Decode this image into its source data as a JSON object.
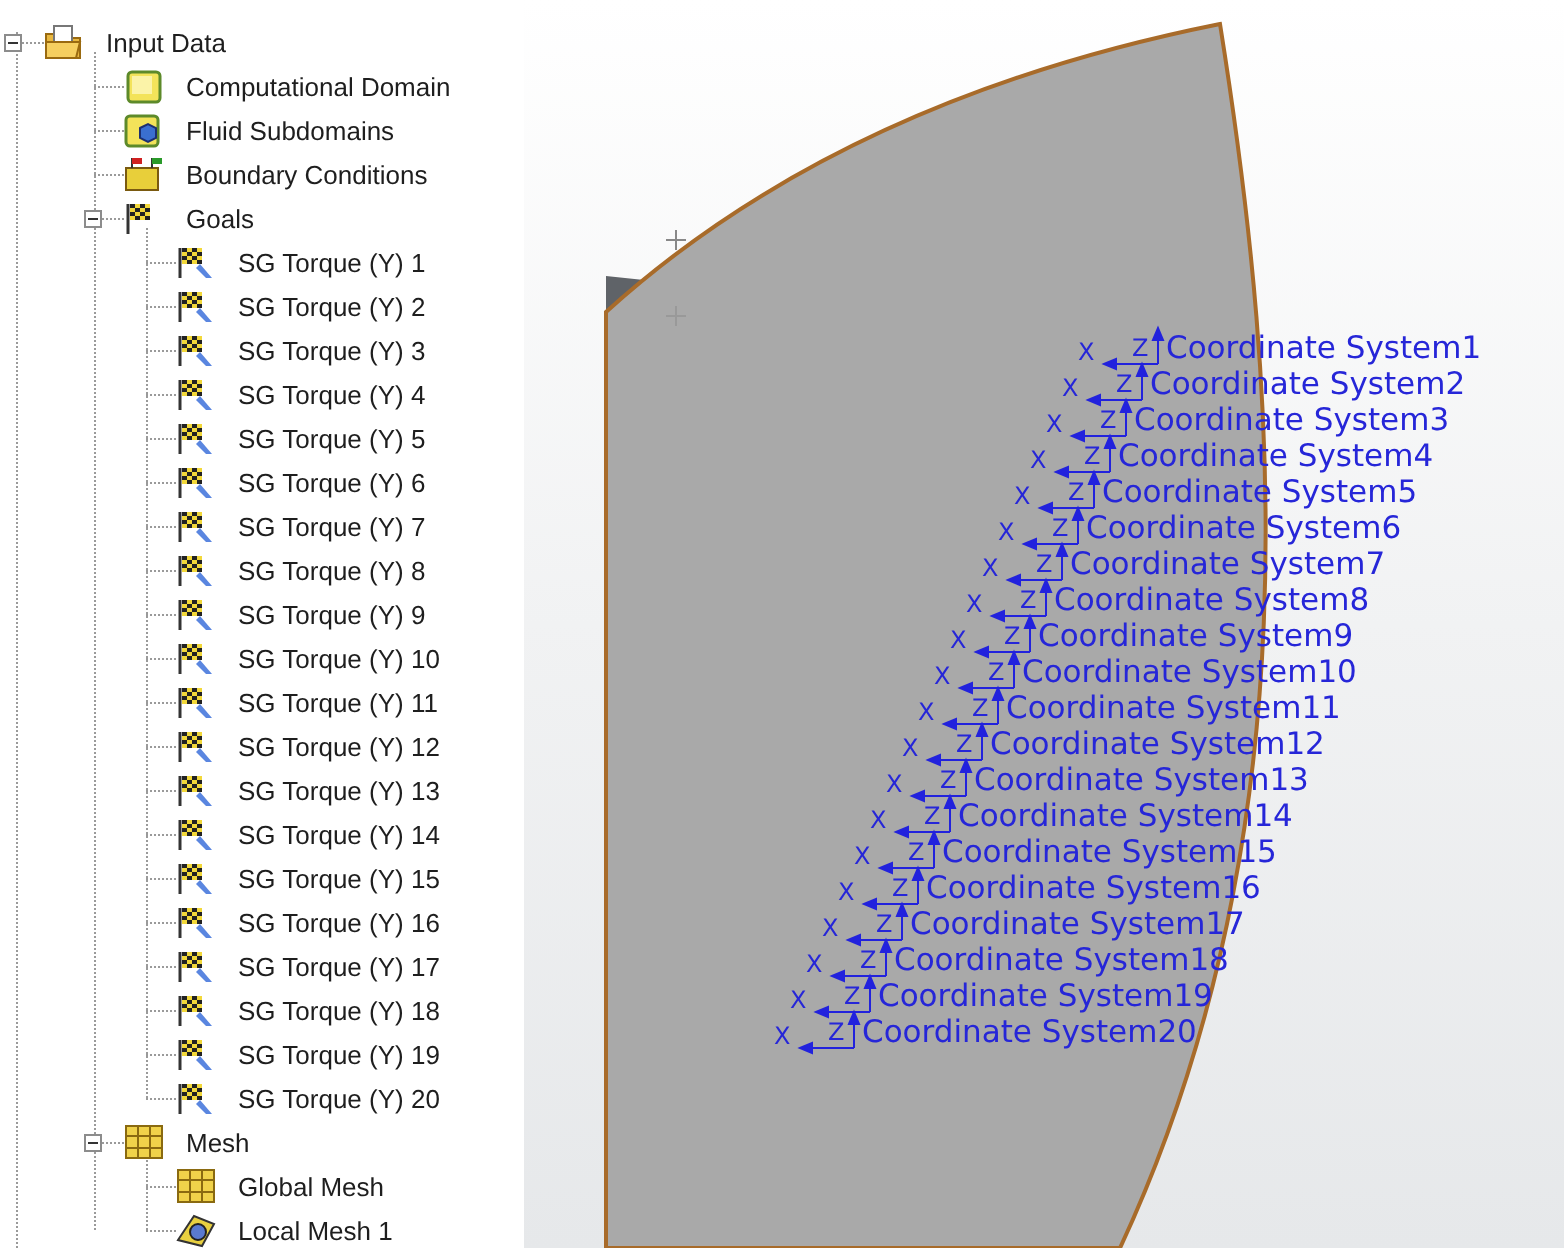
{
  "tree": [
    {
      "label": "Input Data",
      "kind": "folder",
      "expanded": true,
      "children": [
        {
          "label": "Computational Domain",
          "kind": "domain"
        },
        {
          "label": "Fluid Subdomains",
          "kind": "subdomain"
        },
        {
          "label": "Boundary Conditions",
          "kind": "boundary"
        },
        {
          "label": "Goals",
          "kind": "goals",
          "expanded": true,
          "children": [
            {
              "label": "SG Torque (Y) 1",
              "kind": "goal"
            },
            {
              "label": "SG Torque (Y) 2",
              "kind": "goal"
            },
            {
              "label": "SG Torque (Y) 3",
              "kind": "goal"
            },
            {
              "label": "SG Torque (Y) 4",
              "kind": "goal"
            },
            {
              "label": "SG Torque (Y) 5",
              "kind": "goal"
            },
            {
              "label": "SG Torque (Y) 6",
              "kind": "goal"
            },
            {
              "label": "SG Torque (Y) 7",
              "kind": "goal"
            },
            {
              "label": "SG Torque (Y) 8",
              "kind": "goal"
            },
            {
              "label": "SG Torque (Y) 9",
              "kind": "goal"
            },
            {
              "label": "SG Torque (Y) 10",
              "kind": "goal"
            },
            {
              "label": "SG Torque (Y) 11",
              "kind": "goal"
            },
            {
              "label": "SG Torque (Y) 12",
              "kind": "goal"
            },
            {
              "label": "SG Torque (Y) 13",
              "kind": "goal"
            },
            {
              "label": "SG Torque (Y) 14",
              "kind": "goal"
            },
            {
              "label": "SG Torque (Y) 15",
              "kind": "goal"
            },
            {
              "label": "SG Torque (Y) 16",
              "kind": "goal"
            },
            {
              "label": "SG Torque (Y) 17",
              "kind": "goal"
            },
            {
              "label": "SG Torque (Y) 18",
              "kind": "goal"
            },
            {
              "label": "SG Torque (Y) 19",
              "kind": "goal"
            },
            {
              "label": "SG Torque (Y) 20",
              "kind": "goal"
            }
          ]
        },
        {
          "label": "Mesh",
          "kind": "mesh",
          "expanded": true,
          "children": [
            {
              "label": "Global Mesh",
              "kind": "mesh"
            },
            {
              "label": "Local Mesh 1",
              "kind": "local-mesh"
            }
          ]
        }
      ]
    }
  ],
  "viewport": {
    "coordinate_systems": [
      {
        "label": "Coordinate System1",
        "z_axis": "Z",
        "x_axis": "X"
      },
      {
        "label": "Coordinate System2",
        "z_axis": "Z",
        "x_axis": "X"
      },
      {
        "label": "Coordinate System3",
        "z_axis": "Z",
        "x_axis": "X"
      },
      {
        "label": "Coordinate System4",
        "z_axis": "Z",
        "x_axis": "X"
      },
      {
        "label": "Coordinate System5",
        "z_axis": "Z",
        "x_axis": "X"
      },
      {
        "label": "Coordinate System6",
        "z_axis": "Z",
        "x_axis": "X"
      },
      {
        "label": "Coordinate System7",
        "z_axis": "Z",
        "x_axis": "X"
      },
      {
        "label": "Coordinate System8",
        "z_axis": "Z",
        "x_axis": "X"
      },
      {
        "label": "Coordinate System9",
        "z_axis": "Z",
        "x_axis": "X"
      },
      {
        "label": "Coordinate System10",
        "z_axis": "Z",
        "x_axis": "X"
      },
      {
        "label": "Coordinate System11",
        "z_axis": "Z",
        "x_axis": "X"
      },
      {
        "label": "Coordinate System12",
        "z_axis": "Z",
        "x_axis": "X"
      },
      {
        "label": "Coordinate System13",
        "z_axis": "Z",
        "x_axis": "X"
      },
      {
        "label": "Coordinate System14",
        "z_axis": "Z",
        "x_axis": "X"
      },
      {
        "label": "Coordinate System15",
        "z_axis": "Z",
        "x_axis": "X"
      },
      {
        "label": "Coordinate System16",
        "z_axis": "Z",
        "x_axis": "X"
      },
      {
        "label": "Coordinate System17",
        "z_axis": "Z",
        "x_axis": "X"
      },
      {
        "label": "Coordinate System18",
        "z_axis": "Z",
        "x_axis": "X"
      },
      {
        "label": "Coordinate System19",
        "z_axis": "Z",
        "x_axis": "X"
      },
      {
        "label": "Coordinate System20",
        "z_axis": "Z",
        "x_axis": "X"
      }
    ]
  }
}
